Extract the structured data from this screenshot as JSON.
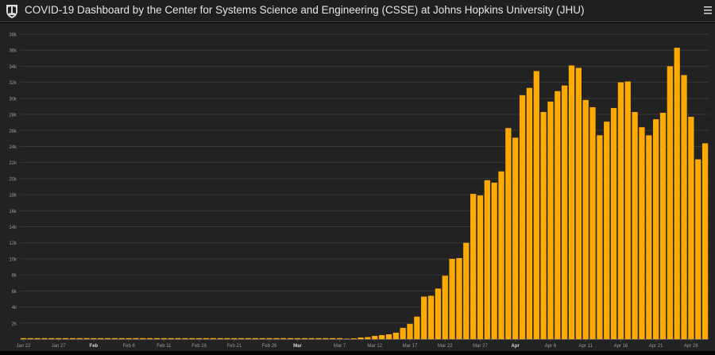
{
  "header": {
    "title": "COVID-19 Dashboard by the Center for Systems Science and Engineering (CSSE) at Johns Hopkins University (JHU)"
  },
  "colors": {
    "bar": "#ffaa00",
    "background": "#222222",
    "header": "#1f1f1f"
  },
  "icons": {
    "logo": "university-shield-icon",
    "menu": "hamburger-menu-icon"
  },
  "chart_data": {
    "type": "bar",
    "title": "",
    "xlabel": "",
    "ylabel": "",
    "ylim": [
      0,
      38000
    ],
    "y_ticks": [
      "2k",
      "4k",
      "6k",
      "8k",
      "10k",
      "12k",
      "14k",
      "16k",
      "18k",
      "20k",
      "22k",
      "24k",
      "26k",
      "28k",
      "30k",
      "32k",
      "34k",
      "36k",
      "38k"
    ],
    "x_ticks": [
      {
        "label": "Jan 22",
        "index": 0,
        "bold": false
      },
      {
        "label": "Jan 27",
        "index": 5,
        "bold": false
      },
      {
        "label": "Feb",
        "index": 10,
        "bold": true
      },
      {
        "label": "Feb 6",
        "index": 15,
        "bold": false
      },
      {
        "label": "Feb 11",
        "index": 20,
        "bold": false
      },
      {
        "label": "Feb 16",
        "index": 25,
        "bold": false
      },
      {
        "label": "Feb 21",
        "index": 30,
        "bold": false
      },
      {
        "label": "Feb 26",
        "index": 35,
        "bold": false
      },
      {
        "label": "Mar",
        "index": 39,
        "bold": true
      },
      {
        "label": "Mar 7",
        "index": 45,
        "bold": false
      },
      {
        "label": "Mar 12",
        "index": 50,
        "bold": false
      },
      {
        "label": "Mar 17",
        "index": 55,
        "bold": false
      },
      {
        "label": "Mar 22",
        "index": 60,
        "bold": false
      },
      {
        "label": "Mar 27",
        "index": 65,
        "bold": false
      },
      {
        "label": "Apr",
        "index": 70,
        "bold": true
      },
      {
        "label": "Apr 6",
        "index": 75,
        "bold": false
      },
      {
        "label": "Apr 11",
        "index": 80,
        "bold": false
      },
      {
        "label": "Apr 16",
        "index": 85,
        "bold": false
      },
      {
        "label": "Apr 21",
        "index": 90,
        "bold": false
      },
      {
        "label": "Apr 26",
        "index": 95,
        "bold": false
      }
    ],
    "start_date": "Jan 22",
    "values": [
      0,
      0,
      0,
      0,
      0,
      0,
      0,
      0,
      0,
      0,
      0,
      0,
      0,
      0,
      0,
      0,
      0,
      0,
      0,
      0,
      0,
      0,
      0,
      0,
      0,
      0,
      0,
      0,
      0,
      0,
      0,
      0,
      0,
      0,
      0,
      0,
      0,
      0,
      0,
      0,
      0,
      0,
      0,
      0,
      0,
      0,
      60,
      100,
      200,
      250,
      400,
      500,
      600,
      800,
      1400,
      1900,
      2800,
      5300,
      5400,
      6300,
      7900,
      10000,
      10100,
      12000,
      18100,
      17900,
      19800,
      19500,
      20900,
      26300,
      25100,
      30400,
      31300,
      33400,
      28300,
      29600,
      30900,
      31600,
      34100,
      33800,
      29800,
      28900,
      25400,
      27100,
      28800,
      32000,
      32100,
      28300,
      26400,
      25400,
      27400,
      28200,
      34000,
      36300,
      32900,
      27700,
      22400,
      24400
    ]
  }
}
